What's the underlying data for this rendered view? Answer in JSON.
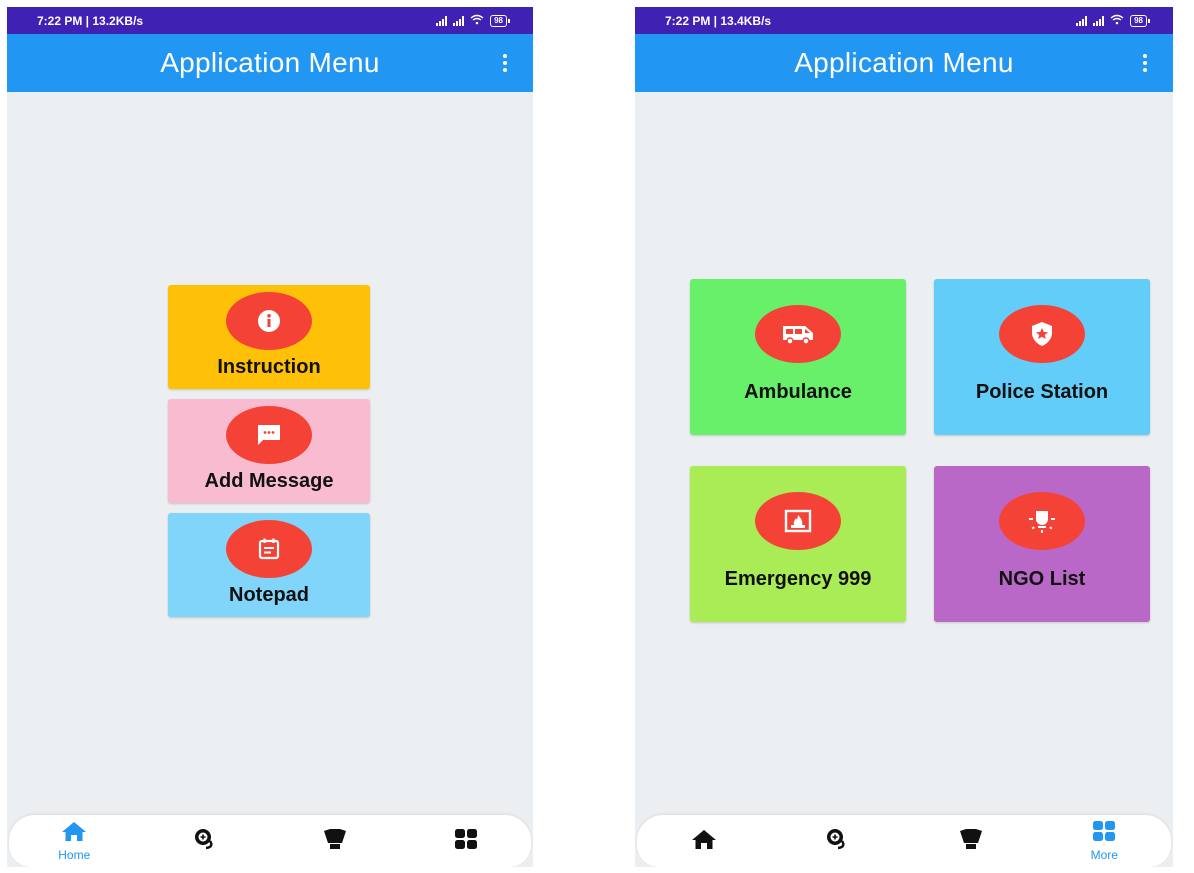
{
  "colors": {
    "status_bar": "#3f22b3",
    "app_bar": "#2196f3",
    "background": "#eceff1",
    "icon_circle": "#f44336",
    "active_nav": "#2196f3"
  },
  "left_screen": {
    "status": {
      "time": "7:22 PM | 13.2KB/s",
      "battery": "98"
    },
    "app_bar": {
      "title": "Application Menu",
      "menu_icon": "more-vert-icon"
    },
    "tiles": [
      {
        "label": "Instruction",
        "icon": "info-icon",
        "color": "#ffc107"
      },
      {
        "label": "Add Message",
        "icon": "message-icon",
        "color": "#f8bbd0"
      },
      {
        "label": "Notepad",
        "icon": "notepad-icon",
        "color": "#81d4fa"
      }
    ],
    "nav": [
      {
        "label": "Home",
        "icon": "home-icon",
        "active": true
      },
      {
        "label": "",
        "icon": "map-pin-icon",
        "active": false
      },
      {
        "label": "",
        "icon": "lamp-icon",
        "active": false
      },
      {
        "label": "",
        "icon": "grid-icon",
        "active": false
      }
    ]
  },
  "right_screen": {
    "status": {
      "time": "7:22 PM | 13.4KB/s",
      "battery": "98"
    },
    "app_bar": {
      "title": "Application Menu",
      "menu_icon": "more-vert-icon"
    },
    "tiles": [
      {
        "label": "Ambulance",
        "icon": "ambulance-icon",
        "color": "#69f06b"
      },
      {
        "label": "Police Station",
        "icon": "police-shield-icon",
        "color": "#62cdf9"
      },
      {
        "label": "Emergency 999",
        "icon": "fire-icon",
        "color": "#a9ec55"
      },
      {
        "label": "NGO List",
        "icon": "lightbulb-icon",
        "color": "#ba68c8"
      }
    ],
    "nav": [
      {
        "label": "",
        "icon": "home-icon",
        "active": false
      },
      {
        "label": "",
        "icon": "map-pin-icon",
        "active": false
      },
      {
        "label": "",
        "icon": "lamp-icon",
        "active": false
      },
      {
        "label": "More",
        "icon": "grid-icon",
        "active": true
      }
    ]
  }
}
